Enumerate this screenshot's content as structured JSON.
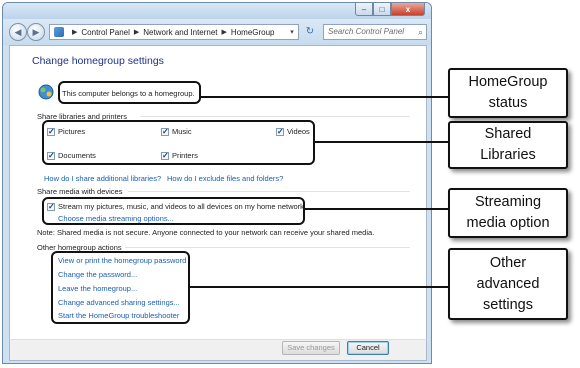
{
  "window": {
    "caption_buttons": {
      "minimize": "–",
      "maximize": "□",
      "close": "x"
    },
    "nav": {
      "back": "◀",
      "forward": "▶"
    },
    "breadcrumb": [
      "Control Panel",
      "Network and Internet",
      "HomeGroup"
    ],
    "search_placeholder": "Search Control Panel"
  },
  "page": {
    "title": "Change homegroup settings",
    "status_text": "This computer belongs to a homegroup."
  },
  "share_libraries": {
    "heading": "Share libraries and printers",
    "items": [
      {
        "label": "Pictures",
        "checked": true
      },
      {
        "label": "Music",
        "checked": true
      },
      {
        "label": "Videos",
        "checked": true
      },
      {
        "label": "Documents",
        "checked": true
      },
      {
        "label": "Printers",
        "checked": true
      }
    ],
    "links": [
      "How do I share additional libraries?",
      "How do I exclude files and folders?"
    ]
  },
  "share_media": {
    "heading": "Share media with devices",
    "stream_label": "Stream my pictures, music, and videos to all devices on my home network",
    "stream_checked": true,
    "options_link": "Choose media streaming options...",
    "note": "Note: Shared media is not secure. Anyone connected to your network can receive your shared media."
  },
  "other_actions": {
    "heading": "Other homegroup actions",
    "links": [
      "View or print the homegroup password",
      "Change the password...",
      "Leave the homegroup...",
      "Change advanced sharing settings...",
      "Start the HomeGroup troubleshooter"
    ]
  },
  "buttons": {
    "save": "Save changes",
    "cancel": "Cancel"
  },
  "callouts": {
    "status": "HomeGroup\nstatus",
    "libraries": "Shared\nLibraries",
    "streaming": "Streaming\nmedia option",
    "other": "Other\nadvanced\nsettings"
  },
  "colors": {
    "link": "#1a5fb4",
    "title": "#1e3287",
    "frame": "#cfe0f1"
  }
}
